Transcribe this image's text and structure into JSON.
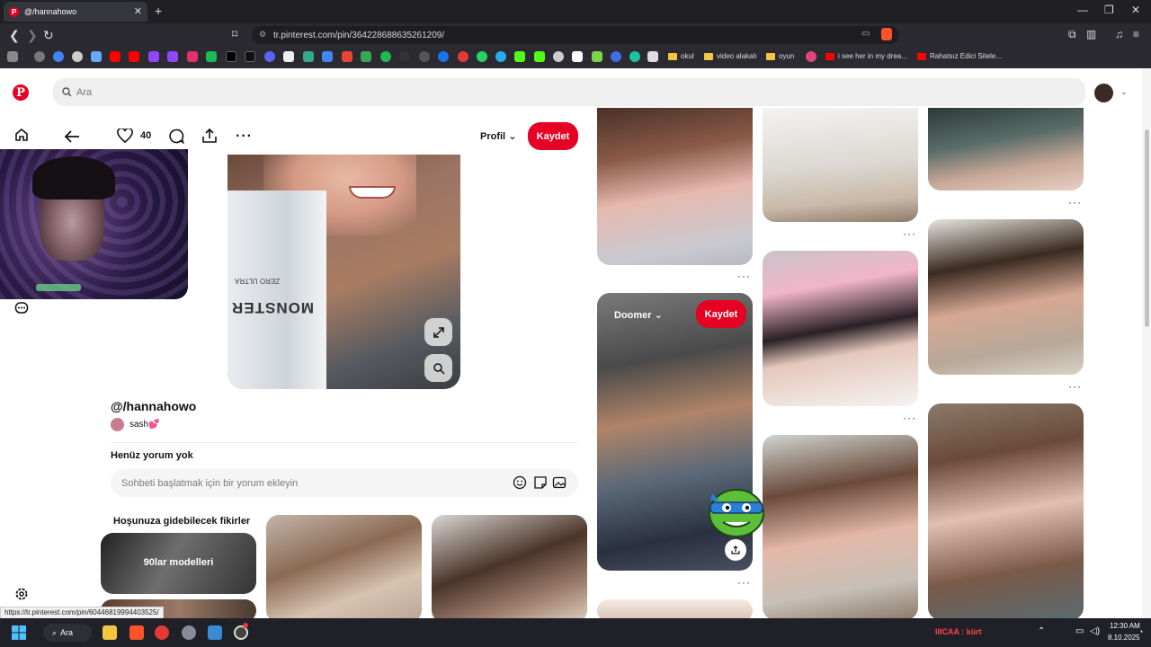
{
  "browser": {
    "tab_title": "@/hannahowo",
    "url": "tr.pinterest.com/pin/364228688635261209/",
    "bookmarks": [
      "okul",
      "video alakalı",
      "oyun",
      "i see her in my drea...",
      "Rahatsız Edici Sitele..."
    ]
  },
  "pinterest": {
    "search_placeholder": "Ara",
    "pin": {
      "likes": "40",
      "profile_label": "Profil",
      "save_label": "Kaydet",
      "title": "@/hannahowo",
      "board_owner": "sash💕",
      "no_comments": "Henüz yorum yok",
      "comment_placeholder": "Sohbeti başlatmak için bir yorum ekleyin",
      "can_text": "MONSTER",
      "can_subtext": "ZERO ULTRA"
    },
    "related": {
      "heading": "Hoşunuza gidebilecek fikirler",
      "first_tile_label": "90lar modelleri"
    },
    "grid": {
      "board_select": "Doomer",
      "save_label": "Kaydet",
      "more": "···"
    }
  },
  "status_url": "https://tr.pinterest.com/pin/60446819994403525/",
  "taskbar": {
    "search_label": "Ara",
    "tray_text": "IIICAA : kürt",
    "time": "12:30 AM",
    "date": "8.10.2025"
  },
  "colors": {
    "brand": "#e60023"
  }
}
